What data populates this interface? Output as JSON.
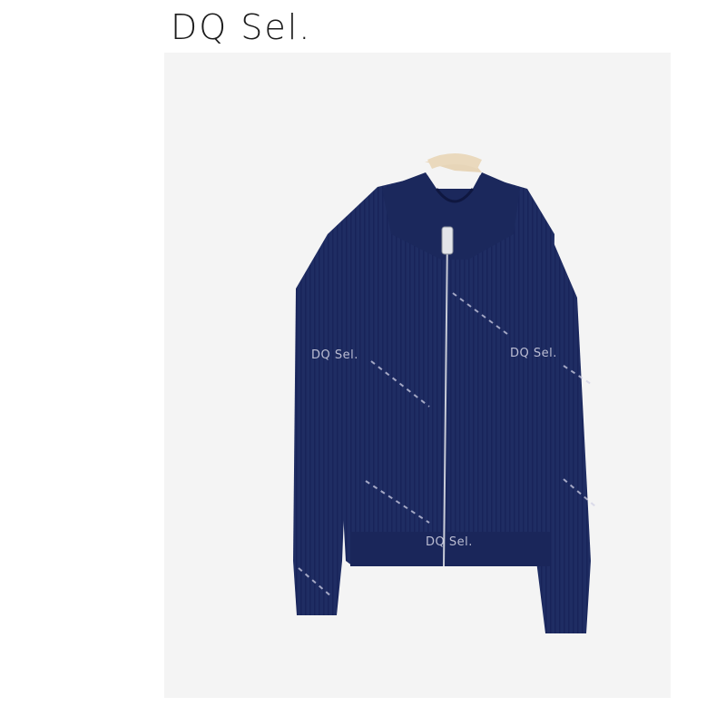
{
  "header": {
    "brand": "DQ Sel."
  },
  "product_image": {
    "description_icon": "zip-cardigan-image",
    "garment_color": "#1f2d63",
    "background_color": "#f4f4f4",
    "watermarks": [
      "DQ Sel.",
      "DQ Sel.",
      "DQ Sel."
    ]
  }
}
